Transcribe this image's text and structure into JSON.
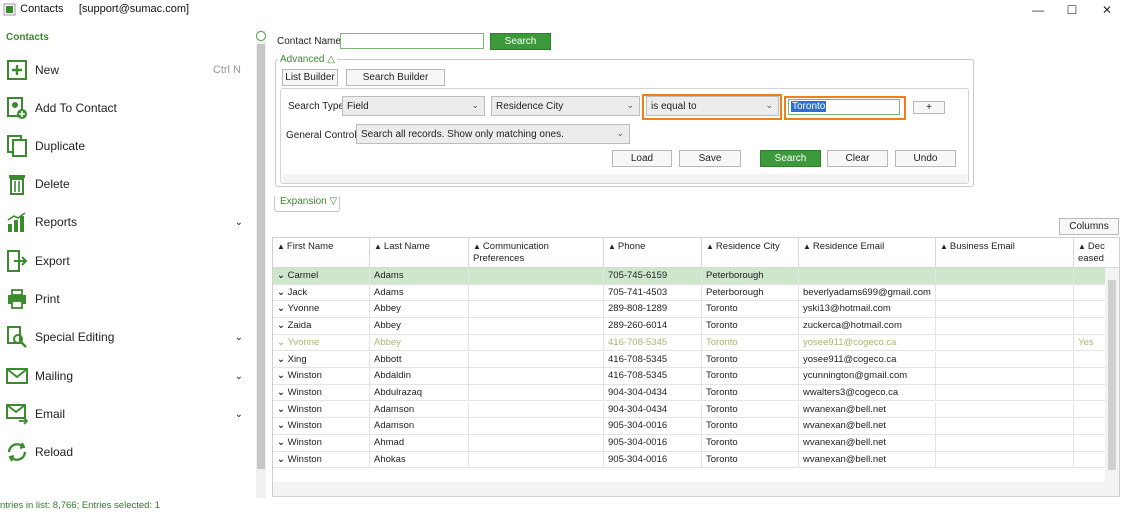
{
  "window": {
    "title": "Contacts",
    "account": "[support@sumac.com]",
    "minimize": "—",
    "maximize": "☐",
    "close": "✕"
  },
  "sidebar": {
    "title": "Contacts",
    "items": [
      {
        "label": "New",
        "icon": "plus-icon",
        "shortcut": "Ctrl N"
      },
      {
        "label": "Add To Contact",
        "icon": "add-contact-icon"
      },
      {
        "label": "Duplicate",
        "icon": "duplicate-icon"
      },
      {
        "label": "Delete",
        "icon": "trash-icon"
      },
      {
        "label": "Reports",
        "icon": "bar-chart-icon",
        "chevron": "⌄"
      },
      {
        "label": "Export",
        "icon": "export-icon"
      },
      {
        "label": "Print",
        "icon": "printer-icon"
      },
      {
        "label": "Special Editing",
        "icon": "special-editing-icon",
        "chevron": "⌄"
      },
      {
        "label": "Mailing",
        "icon": "envelope-icon",
        "chevron": "⌄"
      },
      {
        "label": "Email",
        "icon": "email-icon",
        "chevron": "⌄"
      },
      {
        "label": "Reload",
        "icon": "reload-icon"
      }
    ],
    "accent": "#3a8a2e"
  },
  "search": {
    "contact_name_label": "Contact Name",
    "contact_name_value": "",
    "search_button": "Search",
    "advanced_label": "Advanced △",
    "list_builder": "List Builder",
    "search_builder": "Search Builder",
    "search_type_label": "Search Type:",
    "search_type_value": "Field",
    "field_value": "Residence City",
    "operator_value": "is equal to",
    "criteria_value": "Toronto",
    "add_button": "+",
    "general_control_label": "General Control:",
    "general_control_value": "Search all records. Show only matching ones.",
    "load": "Load",
    "save": "Save",
    "search2": "Search",
    "clear": "Clear",
    "undo": "Undo",
    "expansion_label": "Expansion ▽",
    "columns_button": "Columns"
  },
  "grid": {
    "headers": [
      "First Name",
      "Last Name",
      "Communication Preferences",
      "Phone",
      "Residence City",
      "Residence Email",
      "Business Email",
      "Dec eased"
    ],
    "rows": [
      {
        "first": "Carmel",
        "last": "Adams",
        "comm": "",
        "phone": "705-745-6159",
        "city": "Peterborough",
        "email": "",
        "business": "",
        "deceased": "",
        "selected": true
      },
      {
        "first": "Jack",
        "last": "Adams",
        "comm": "",
        "phone": "705-741-4503",
        "city": "Peterborough",
        "email": "beverlyadams699@gmail.com",
        "business": "",
        "deceased": ""
      },
      {
        "first": "Yvonne",
        "last": "Abbey",
        "comm": "",
        "phone": "289-808-1289",
        "city": "Toronto",
        "email": "yski13@hotmail.com",
        "business": "",
        "deceased": ""
      },
      {
        "first": "Zaida",
        "last": "Abbey",
        "comm": "",
        "phone": "289-260-6014",
        "city": "Toronto",
        "email": "zuckerca@hotmail.com",
        "business": "",
        "deceased": ""
      },
      {
        "first": "Yvonne",
        "last": "Abbey",
        "comm": "",
        "phone": "416-708-5345",
        "city": "Toronto",
        "email": "yosee911@cogeco.ca",
        "business": "",
        "deceased": "Yes",
        "muted": true
      },
      {
        "first": "Xing",
        "last": "Abbott",
        "comm": "",
        "phone": "416-708-5345",
        "city": "Toronto",
        "email": "yosee911@cogeco.ca",
        "business": "",
        "deceased": ""
      },
      {
        "first": "Winston",
        "last": "Abdaldin",
        "comm": "",
        "phone": "416-708-5345",
        "city": "Toronto",
        "email": "ycunnington@gmail.com",
        "business": "",
        "deceased": ""
      },
      {
        "first": "Winston",
        "last": "Abdulrazaq",
        "comm": "",
        "phone": "904-304-0434",
        "city": "Toronto",
        "email": "wwalters3@cogeco.ca",
        "business": "",
        "deceased": ""
      },
      {
        "first": "Winston",
        "last": "Adamson",
        "comm": "",
        "phone": "904-304-0434",
        "city": "Toronto",
        "email": "wvanexan@bell.net",
        "business": "",
        "deceased": ""
      },
      {
        "first": "Winston",
        "last": "Adamson",
        "comm": "",
        "phone": "905-304-0016",
        "city": "Toronto",
        "email": "wvanexan@bell.net",
        "business": "",
        "deceased": ""
      },
      {
        "first": "Winston",
        "last": "Ahmad",
        "comm": "",
        "phone": "905-304-0016",
        "city": "Toronto",
        "email": "wvanexan@bell.net",
        "business": "",
        "deceased": ""
      },
      {
        "first": "Winston",
        "last": "Ahokas",
        "comm": "",
        "phone": "905-304-0016",
        "city": "Toronto",
        "email": "wvanexan@bell.net",
        "business": "",
        "deceased": ""
      }
    ]
  },
  "status": {
    "text": "ntries in list: 8,766; Entries selected: 1"
  }
}
